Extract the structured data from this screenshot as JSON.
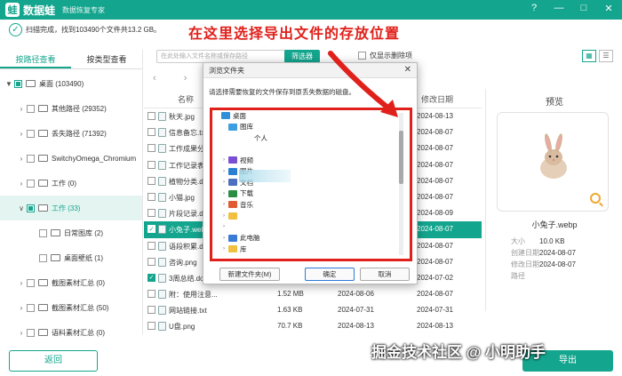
{
  "app": {
    "name": "数据蛙",
    "subtitle": "数据恢复专家",
    "logo_text": "蛙"
  },
  "window_buttons": [
    "?",
    "—",
    "□",
    "✕"
  ],
  "status_text": "扫描完成，找到103490个文件共13.2 GB。",
  "headline": "在这里选择导出文件的存放位置",
  "tabs": [
    "按路径查看",
    "按类型查看"
  ],
  "tree": [
    {
      "label": "桌面 (103490)",
      "indent": 0,
      "arrow": "▼",
      "check": "partial",
      "active": false
    },
    {
      "label": "其他路径 (29352)",
      "indent": 1,
      "arrow": "›",
      "check": "none",
      "active": false
    },
    {
      "label": "丢失路径 (71392)",
      "indent": 1,
      "arrow": "›",
      "check": "none",
      "active": false
    },
    {
      "label": "SwitchyOmega_Chromium",
      "indent": 1,
      "arrow": "›",
      "check": "none",
      "active": false
    },
    {
      "label": "工作 (0)",
      "indent": 1,
      "arrow": "›",
      "check": "none",
      "active": false
    },
    {
      "label": "工作 (33)",
      "indent": 1,
      "arrow": "∨",
      "check": "partial",
      "active": true
    },
    {
      "label": "日常图库 (2)",
      "indent": 2,
      "arrow": "",
      "check": "none",
      "active": false
    },
    {
      "label": "桌面壁纸 (1)",
      "indent": 2,
      "arrow": "",
      "check": "none",
      "active": false
    },
    {
      "label": "截图素材汇总 (0)",
      "indent": 1,
      "arrow": "›",
      "check": "none",
      "active": false
    },
    {
      "label": "截图素材汇总 (50)",
      "indent": 1,
      "arrow": "›",
      "check": "none",
      "active": false
    },
    {
      "label": "语料素材汇总 (0)",
      "indent": 1,
      "arrow": "›",
      "check": "none",
      "active": false
    }
  ],
  "toolbar": {
    "search_placeholder": "在此处输入文件名称或保存路径",
    "filter_label": "筛选器",
    "only_deleted_label": "仅显示删除项",
    "view_icons": [
      "▦",
      "☰"
    ]
  },
  "nav_arrows": "‹ ›",
  "list_headers": {
    "name": "名称",
    "modified": "修改日期"
  },
  "files": [
    {
      "name": "秋天.jpg",
      "size": "",
      "date1": "",
      "date2": "2024-08-13",
      "checked": false,
      "selected": false
    },
    {
      "name": "信息备忘.txt",
      "size": "",
      "date1": "",
      "date2": "2024-08-07",
      "checked": false,
      "selected": false
    },
    {
      "name": "工作成果分",
      "size": "",
      "date1": "",
      "date2": "2024-08-07",
      "checked": false,
      "selected": false
    },
    {
      "name": "工作记录表",
      "size": "",
      "date1": "",
      "date2": "2024-08-07",
      "checked": false,
      "selected": false
    },
    {
      "name": "植物分类.d",
      "size": "",
      "date1": "",
      "date2": "2024-08-07",
      "checked": false,
      "selected": false
    },
    {
      "name": "小猫.jpg",
      "size": "",
      "date1": "",
      "date2": "2024-08-07",
      "checked": false,
      "selected": false
    },
    {
      "name": "片段记录.d",
      "size": "",
      "date1": "",
      "date2": "2024-08-09",
      "checked": false,
      "selected": false
    },
    {
      "name": "小兔子.web",
      "size": "",
      "date1": "",
      "date2": "2024-08-07",
      "checked": true,
      "selected": true
    },
    {
      "name": "语段积累.d",
      "size": "",
      "date1": "",
      "date2": "2024-08-07",
      "checked": false,
      "selected": false
    },
    {
      "name": "咨询.png",
      "size": "",
      "date1": "",
      "date2": "2024-08-07",
      "checked": false,
      "selected": false
    },
    {
      "name": "3周总结.docx",
      "size": "",
      "date1": "",
      "date2": "2024-07-02",
      "checked": true,
      "selected": false
    },
    {
      "name": "附：使用注意...",
      "size": "1.52 MB",
      "date1": "2024-08-06",
      "date2": "2024-08-07",
      "checked": false,
      "selected": false
    },
    {
      "name": "网站链接.txt",
      "size": "1.63 KB",
      "date1": "2024-07-31",
      "date2": "2024-07-31",
      "checked": false,
      "selected": false
    },
    {
      "name": "U盘.png",
      "size": "70.7 KB",
      "date1": "2024-08-13",
      "date2": "2024-08-13",
      "checked": false,
      "selected": false
    }
  ],
  "preview": {
    "title": "预览",
    "filename": "小兔子.webp",
    "meta": [
      {
        "key": "大小",
        "value": "10.0 KB"
      },
      {
        "key": "创建日期",
        "value": "2024-08-07"
      },
      {
        "key": "修改日期",
        "value": "2024-08-07"
      },
      {
        "key": "路径",
        "value": ""
      }
    ]
  },
  "back_label": "返回",
  "export_label": "导出",
  "watermark": "掘金技术社区 @ 小明助手",
  "dialog": {
    "title": "浏览文件夹",
    "close": "✕",
    "prompt": "请选择需要恢复的文件保存到原丢失数据的磁盘。",
    "tree": [
      {
        "label": "桌面",
        "arrow": "",
        "indent": 0,
        "color": "#2f8fd8"
      },
      {
        "label": "图库",
        "arrow": "",
        "indent": 1,
        "color": "#3c9ee0"
      },
      {
        "label": "个人",
        "arrow": "",
        "indent": 3,
        "color": "#ffffff"
      },
      {
        "label": "",
        "arrow": "",
        "indent": 1,
        "color": "#ffffff"
      },
      {
        "label": "视频",
        "arrow": "›",
        "indent": 1,
        "color": "#7a4fd3"
      },
      {
        "label": "图片",
        "arrow": "›",
        "indent": 1,
        "color": "#2a7fd1"
      },
      {
        "label": "文档",
        "arrow": "›",
        "indent": 1,
        "color": "#4d6fbf"
      },
      {
        "label": "下载",
        "arrow": "›",
        "indent": 1,
        "color": "#2c8e46"
      },
      {
        "label": "音乐",
        "arrow": "›",
        "indent": 1,
        "color": "#e25a34"
      },
      {
        "label": "",
        "arrow": "›",
        "indent": 1,
        "color": "#f0c040"
      },
      {
        "label": "",
        "arrow": "›",
        "indent": 1,
        "color": "#ffffff"
      },
      {
        "label": "此电脑",
        "arrow": "›",
        "indent": 1,
        "color": "#3a7bd5"
      },
      {
        "label": "库",
        "arrow": "›",
        "indent": 1,
        "color": "#f0c040"
      }
    ],
    "new_folder": "新建文件夹(M)",
    "ok": "确定",
    "cancel": "取消"
  },
  "colors": {
    "accent": "#14a58e",
    "highlight": "#e0201a"
  }
}
